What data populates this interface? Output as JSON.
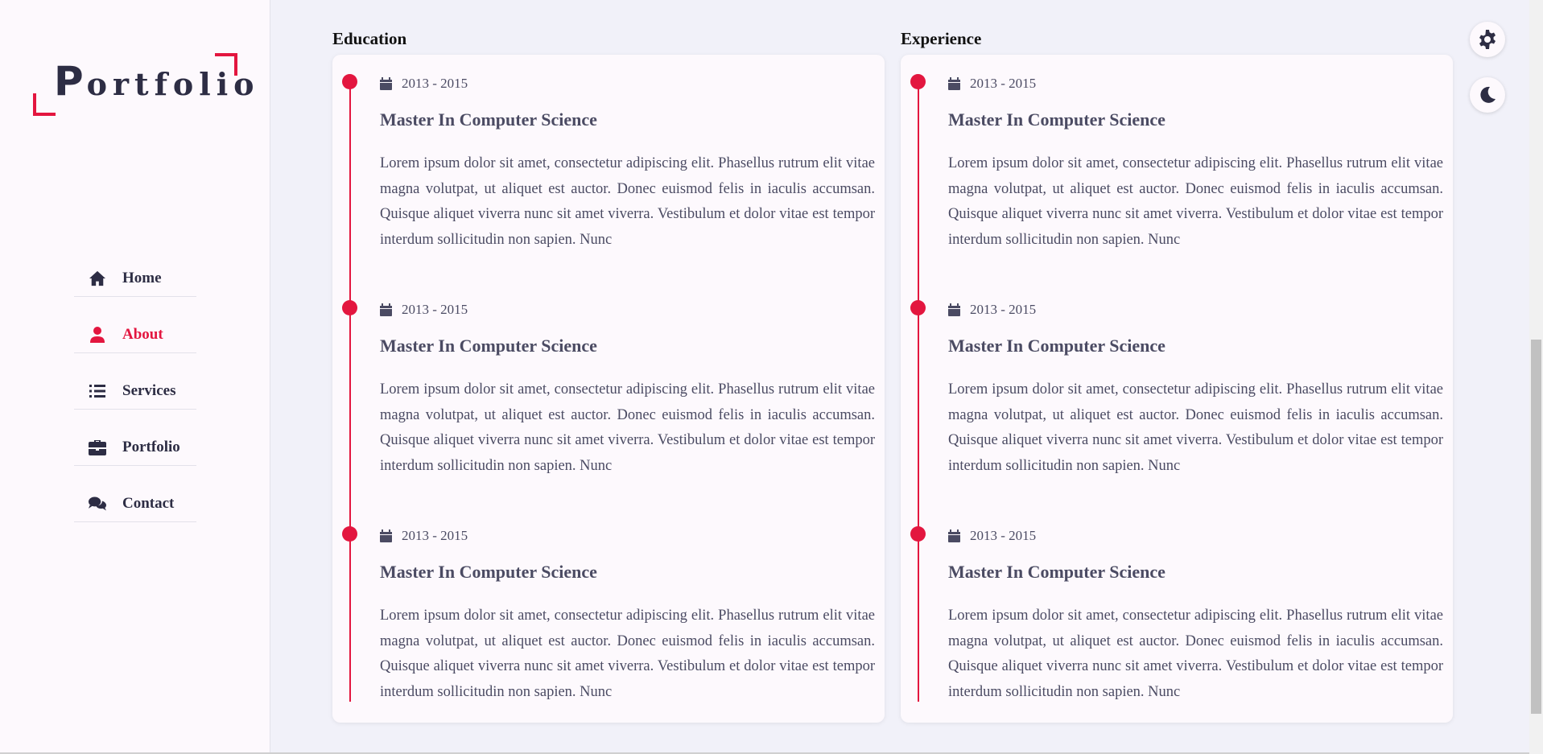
{
  "logo": {
    "first": "P",
    "rest": "ortfolio"
  },
  "nav": [
    {
      "label": "Home",
      "icon": "home-icon"
    },
    {
      "label": "About",
      "icon": "user-icon",
      "active": true
    },
    {
      "label": "Services",
      "icon": "list-icon"
    },
    {
      "label": "Portfolio",
      "icon": "briefcase-icon"
    },
    {
      "label": "Contact",
      "icon": "comments-icon"
    }
  ],
  "education": {
    "heading": "Education",
    "entries": [
      {
        "date": "2013 - 2015",
        "title": "Master In Computer Science",
        "text": "Lorem ipsum dolor sit amet, consectetur adipiscing elit. Phasellus rutrum elit vitae magna volutpat, ut aliquet est auctor. Donec euismod felis in iaculis accumsan. Quisque aliquet viverra nunc sit amet viverra. Vestibulum et dolor vitae est tempor interdum sollicitudin non sapien. Nunc"
      },
      {
        "date": "2013 - 2015",
        "title": "Master In Computer Science",
        "text": "Lorem ipsum dolor sit amet, consectetur adipiscing elit. Phasellus rutrum elit vitae magna volutpat, ut aliquet est auctor. Donec euismod felis in iaculis accumsan. Quisque aliquet viverra nunc sit amet viverra. Vestibulum et dolor vitae est tempor interdum sollicitudin non sapien. Nunc"
      },
      {
        "date": "2013 - 2015",
        "title": "Master In Computer Science",
        "text": "Lorem ipsum dolor sit amet, consectetur adipiscing elit. Phasellus rutrum elit vitae magna volutpat, ut aliquet est auctor. Donec euismod felis in iaculis accumsan. Quisque aliquet viverra nunc sit amet viverra. Vestibulum et dolor vitae est tempor interdum sollicitudin non sapien. Nunc"
      }
    ]
  },
  "experience": {
    "heading": "Experience",
    "entries": [
      {
        "date": "2013 - 2015",
        "title": "Master In Computer Science",
        "text": "Lorem ipsum dolor sit amet, consectetur adipiscing elit. Phasellus rutrum elit vitae magna volutpat, ut aliquet est auctor. Donec euismod felis in iaculis accumsan. Quisque aliquet viverra nunc sit amet viverra. Vestibulum et dolor vitae est tempor interdum sollicitudin non sapien. Nunc"
      },
      {
        "date": "2013 - 2015",
        "title": "Master In Computer Science",
        "text": "Lorem ipsum dolor sit amet, consectetur adipiscing elit. Phasellus rutrum elit vitae magna volutpat, ut aliquet est auctor. Donec euismod felis in iaculis accumsan. Quisque aliquet viverra nunc sit amet viverra. Vestibulum et dolor vitae est tempor interdum sollicitudin non sapien. Nunc"
      },
      {
        "date": "2013 - 2015",
        "title": "Master In Computer Science",
        "text": "Lorem ipsum dolor sit amet, consectetur adipiscing elit. Phasellus rutrum elit vitae magna volutpat, ut aliquet est auctor. Donec euismod felis in iaculis accumsan. Quisque aliquet viverra nunc sit amet viverra. Vestibulum et dolor vitae est tempor interdum sollicitudin non sapien. Nunc"
      }
    ]
  },
  "floating_buttons": [
    {
      "icon": "gear-icon"
    },
    {
      "icon": "moon-icon"
    }
  ],
  "colors": {
    "accent": "#e3163f",
    "text": "#2d2d44",
    "background": "#f1f1f9",
    "panel": "#fdf9fd"
  }
}
